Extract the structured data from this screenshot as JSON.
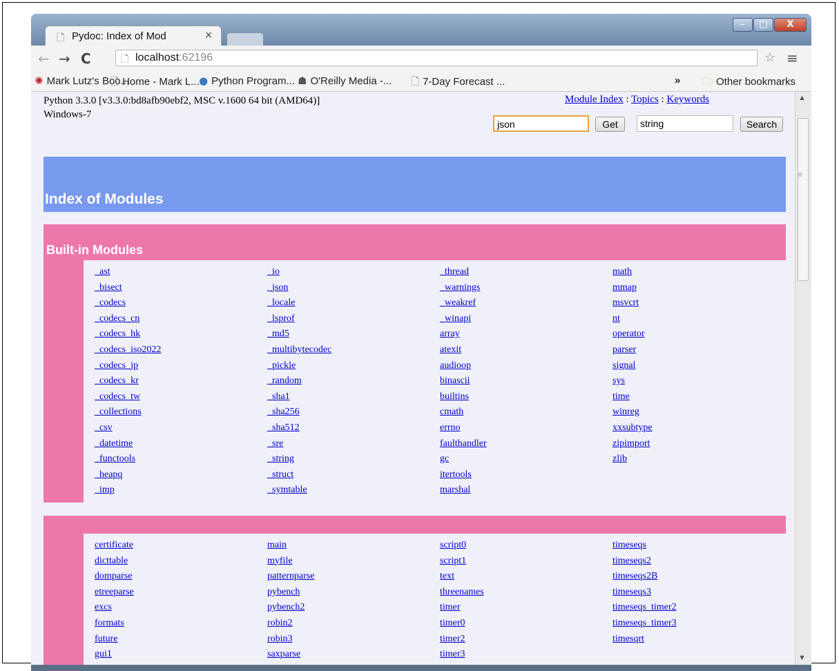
{
  "browser": {
    "tab_title": "Pydoc: Index of Mod",
    "tab_close": "×",
    "url_host": "localhost",
    "url_port": ":62196",
    "bookmarks": [
      {
        "label": "Mark Lutz's Boo...",
        "icon": "oreilly-book-icon"
      },
      {
        "label": "Home - Mark L...",
        "icon": "page-icon"
      },
      {
        "label": "Python Program...",
        "icon": "python-icon"
      },
      {
        "label": "O'Reilly Media -...",
        "icon": "oreilly-icon"
      },
      {
        "label": "7-Day Forecast ...",
        "icon": "page-icon"
      }
    ],
    "overflow": "»",
    "other_bookmarks": "Other bookmarks"
  },
  "pydoc": {
    "python_version": "Python 3.3.0 [v3.3.0:bd8afb90ebf2, MSC v.1600 64 bit (AMD64)]",
    "platform": "Windows-7",
    "links": {
      "module_index": "Module Index",
      "sep1": " : ",
      "topics": "Topics",
      "sep2": " : ",
      "keywords": "Keywords"
    },
    "get_field_value": "json",
    "get_button": "Get",
    "search_field_value": "string",
    "search_button": "Search",
    "page_heading": "Index of Modules",
    "builtin_heading": "Built-in Modules",
    "builtin_columns": [
      [
        "_ast",
        "_bisect",
        "_codecs",
        "_codecs_cn",
        "_codecs_hk",
        "_codecs_iso2022",
        "_codecs_jp",
        "_codecs_kr",
        "_codecs_tw",
        "_collections",
        "_csv",
        "_datetime",
        "_functools",
        "_heapq",
        "_imp"
      ],
      [
        "_io",
        "_json",
        "_locale",
        "_lsprof",
        "_md5",
        "_multibytecodec",
        "_pickle",
        "_random",
        "_sha1",
        "_sha256",
        "_sha512",
        "_sre",
        "_string",
        "_struct",
        "_symtable"
      ],
      [
        "_thread",
        "_warnings",
        "_weakref",
        "_winapi",
        "array",
        "atexit",
        "audioop",
        "binascii",
        "builtins",
        "cmath",
        "errno",
        "faulthandler",
        "gc",
        "itertools",
        "marshal"
      ],
      [
        "math",
        "mmap",
        "msvcrt",
        "nt",
        "operator",
        "parser",
        "signal",
        "sys",
        "time",
        "winreg",
        "xxsubtype",
        "zipimport",
        "zlib"
      ]
    ],
    "second_heading": "",
    "second_columns": [
      [
        "certificate",
        "dicttable",
        "domparse",
        "etreeparse",
        "excs",
        "formats",
        "future",
        "gui1"
      ],
      [
        "main",
        "myfile",
        "patternparse",
        "pybench",
        "pybench2",
        "robin2",
        "robin3",
        "saxparse"
      ],
      [
        "script0",
        "script1",
        "text",
        "threenames",
        "timer",
        "timer0",
        "timer2",
        "timer3"
      ],
      [
        "timeseqs",
        "timeseqs2",
        "timeseqs2B",
        "timeseqs3",
        "timeseqs_timer2",
        "timeseqs_timer3",
        "timesqrt"
      ]
    ]
  },
  "colors": {
    "heading_bg": "#7799ee",
    "section_bg": "#ee77aa",
    "page_bg": "#f0f0f8",
    "link": "#0000cc"
  }
}
